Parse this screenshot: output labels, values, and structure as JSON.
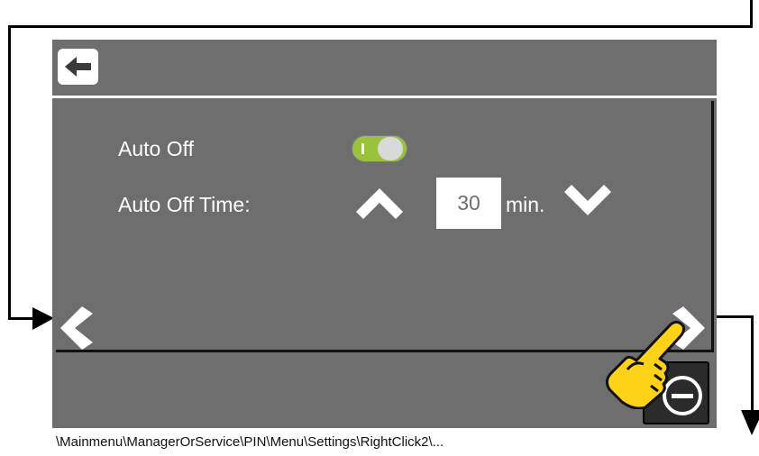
{
  "settings": {
    "auto_off_label": "Auto Off",
    "auto_off_enabled": true,
    "auto_off_time_label": "Auto Off Time:",
    "auto_off_time_value": "30",
    "auto_off_time_unit": "min."
  },
  "navigation": {
    "back_icon": "arrow-left-icon",
    "prev_icon": "chevron-left-icon",
    "next_icon": "chevron-right-icon",
    "up_icon": "chevron-up-icon",
    "down_icon": "chevron-down-icon",
    "exit_icon": "minus-circle-icon"
  },
  "annotation": {
    "path": "\\Mainmenu\\ManagerOrService\\PIN\\Menu\\Settings\\RightClick2\\...",
    "pointer_icon": "pointing-hand-icon"
  },
  "colors": {
    "screen_bg": "#6e6e6e",
    "toggle_on": "#9bc23c",
    "hand": "#ffd21a"
  }
}
